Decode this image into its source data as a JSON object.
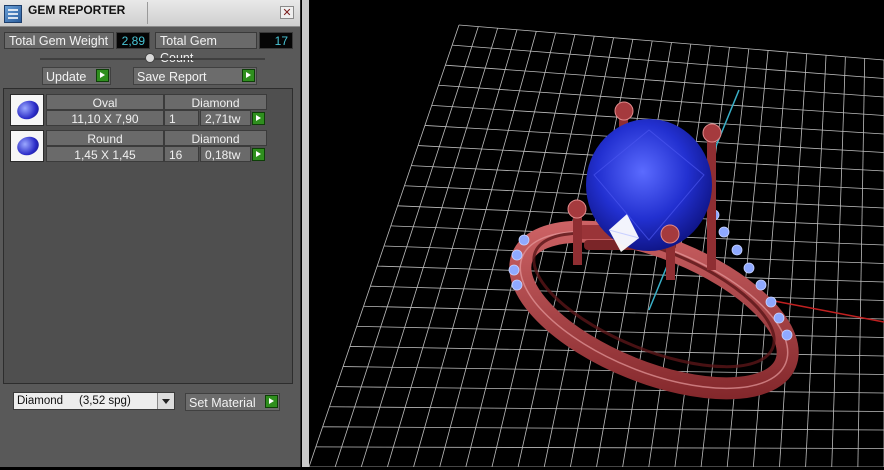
{
  "window": {
    "title": "GEM REPORTER"
  },
  "stats": {
    "weight_label": "Total Gem Weight",
    "weight_value": "2,89",
    "count_label": "Total Gem Count",
    "count_value": "17"
  },
  "toolbar": {
    "update_label": "Update",
    "save_label": "Save Report"
  },
  "gems": [
    {
      "shape": "Oval",
      "material": "Diamond",
      "size": "11,10 X 7,90",
      "count": "1",
      "weight": "2,71tw"
    },
    {
      "shape": "Round",
      "material": "Diamond",
      "size": "1,45 X 1,45",
      "count": "16",
      "weight": "0,18tw"
    }
  ],
  "material": {
    "selected": "Diamond     (3,52 spg)",
    "set_label": "Set Material"
  },
  "colors": {
    "panel": "#595959",
    "accent_value": "#49c5d6",
    "go_button": "#2f8f1e",
    "metal": "#b5484c",
    "stone": "#2b3fd6",
    "grid": "#bdbdbd"
  },
  "icons": [
    "app-icon",
    "close-icon",
    "gem-icon",
    "play-icon",
    "chevron-down-icon"
  ]
}
